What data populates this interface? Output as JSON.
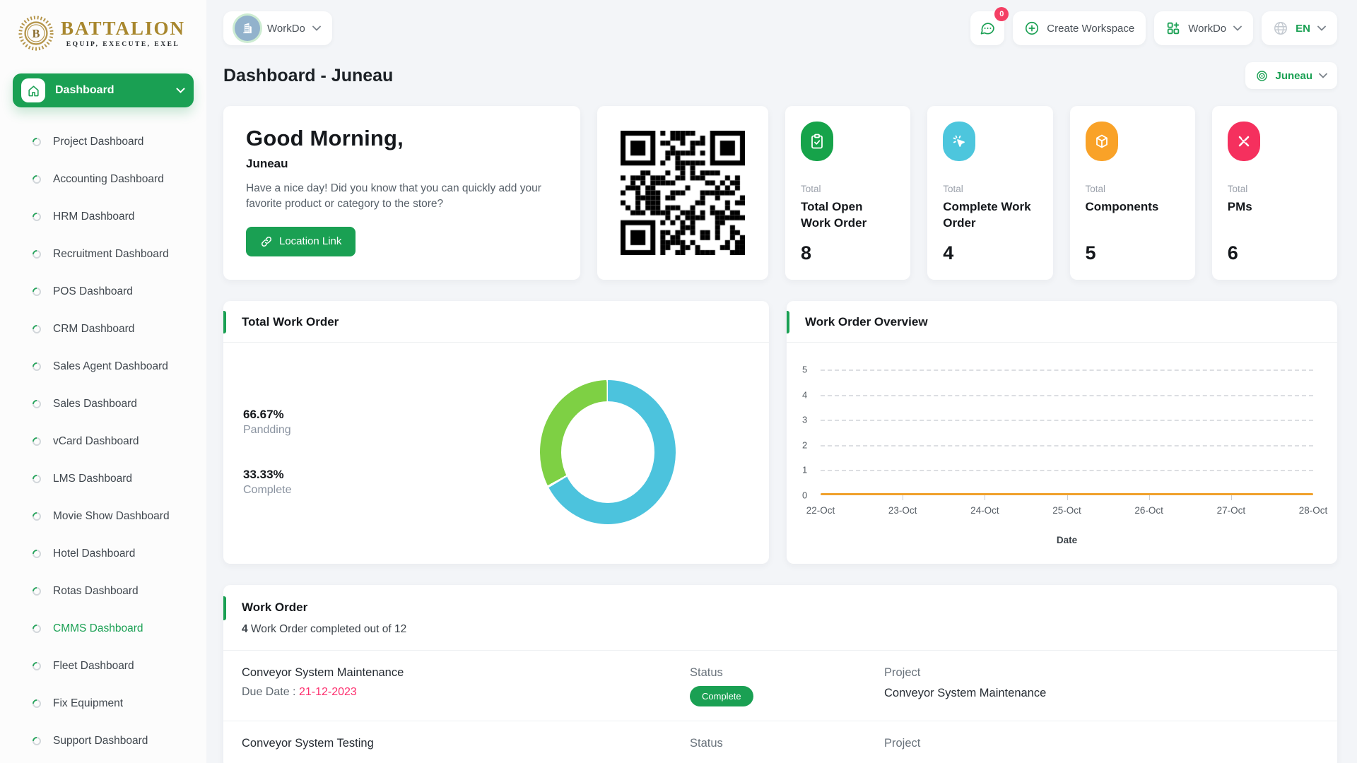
{
  "brand": {
    "name": "BATTALION",
    "tagline": "EQUIP, EXECUTE, EXEL"
  },
  "topbar": {
    "workspace": {
      "name": "WorkDo"
    },
    "chat": {
      "badge": "0"
    },
    "create_workspace": "Create Workspace",
    "apps_menu": "WorkDo",
    "language": "EN"
  },
  "sidebar": {
    "main": "Dashboard",
    "items": [
      {
        "label": "Project Dashboard"
      },
      {
        "label": "Accounting Dashboard"
      },
      {
        "label": "HRM Dashboard"
      },
      {
        "label": "Recruitment Dashboard"
      },
      {
        "label": "POS Dashboard"
      },
      {
        "label": "CRM Dashboard"
      },
      {
        "label": "Sales Agent Dashboard"
      },
      {
        "label": "Sales Dashboard"
      },
      {
        "label": "vCard Dashboard"
      },
      {
        "label": "LMS Dashboard"
      },
      {
        "label": "Movie Show Dashboard"
      },
      {
        "label": "Hotel Dashboard"
      },
      {
        "label": "Rotas Dashboard"
      },
      {
        "label": "CMMS Dashboard"
      },
      {
        "label": "Fleet Dashboard"
      },
      {
        "label": "Fix Equipment"
      },
      {
        "label": "Support Dashboard"
      }
    ]
  },
  "page": {
    "title": "Dashboard - Juneau",
    "location": "Juneau"
  },
  "greeting": {
    "title": "Good Morning,",
    "name": "Juneau",
    "message": "Have a nice day! Did you know that you can quickly add your favorite product or category to the store?",
    "button": "Location Link"
  },
  "stats": [
    {
      "label": "Total",
      "title": "Total Open Work Order",
      "value": "8",
      "color": "#16a34a",
      "icon": "clipboard-check"
    },
    {
      "label": "Total",
      "title": "Complete Work Order",
      "value": "4",
      "color": "#4dc6dd",
      "icon": "cursor-click"
    },
    {
      "label": "Total",
      "title": "Components",
      "value": "5",
      "color": "#f9a228",
      "icon": "cube"
    },
    {
      "label": "Total",
      "title": "PMs",
      "value": "6",
      "color": "#f5305e",
      "icon": "tools"
    }
  ],
  "chart_data": [
    {
      "type": "pie",
      "title": "Total Work Order",
      "labels": [
        "Pandding",
        "Complete"
      ],
      "values": [
        66.67,
        33.33
      ],
      "display": [
        "66.67%",
        "33.33%"
      ],
      "colors": [
        "#4cc3dd",
        "#7ed044"
      ],
      "legend_position": "left"
    },
    {
      "type": "line",
      "title": "Work Order Overview",
      "x": [
        "22-Oct",
        "23-Oct",
        "24-Oct",
        "25-Oct",
        "26-Oct",
        "27-Oct",
        "28-Oct"
      ],
      "series": [
        {
          "name": "Work Order",
          "values": [
            0,
            0,
            0,
            0,
            0,
            0,
            0
          ]
        }
      ],
      "yticks": [
        0,
        1,
        2,
        3,
        4,
        5
      ],
      "ylim": [
        0,
        5
      ],
      "xlabel": "Date",
      "line_color": "#f0a12c",
      "grid": "dashed-horizontal"
    }
  ],
  "work_orders": {
    "title": "Work Order",
    "completed_count": "4",
    "summary_suffix": " Work Order completed out of 12",
    "due_prefix": "Due Date : ",
    "status_header": "Status",
    "project_header": "Project",
    "rows": [
      {
        "name": "Conveyor System Maintenance",
        "due_date": "21-12-2023",
        "status": "Complete",
        "project": "Conveyor System Maintenance"
      },
      {
        "name": "Conveyor System Testing"
      }
    ]
  },
  "colors": {
    "primary_green": "#1aa053",
    "badge_pink": "#f43f64",
    "due_date_pink": "#fd2f6e",
    "donut_teal": "#4cc3dd",
    "donut_green": "#7ed044",
    "line_orange": "#f0a12c",
    "stat_teal": "#4dc6dd",
    "stat_orange": "#f9a228",
    "stat_pink": "#f5305e"
  }
}
